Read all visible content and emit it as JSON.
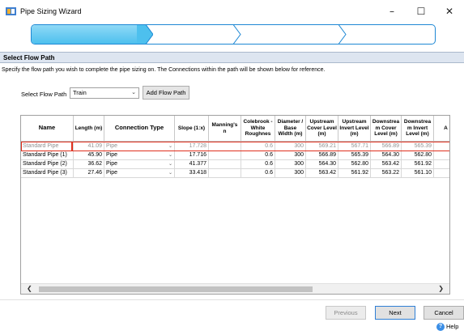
{
  "window": {
    "title": "Pipe Sizing Wizard",
    "minimize": "–",
    "maximize": "☐",
    "close": "✕"
  },
  "section": {
    "title": "Select Flow Path",
    "instruction": "Specify the flow path you wish to complete the pipe sizing on. The Connections within the path will be shown below for reference."
  },
  "flow_path": {
    "label": "Select Flow Path",
    "value": "Train",
    "add_button": "Add Flow Path"
  },
  "table": {
    "columns": [
      "Name",
      "Length (m)",
      "Connection Type",
      "Slope (1:x)",
      "Manning's n",
      "Colebrook -White Roughnes",
      "Diameter / Base Width (m)",
      "Upstream Cover Level (m)",
      "Upstream Invert Level (m)",
      "Downstrea m Cover Level (m)",
      "Downstrea m Invert Level (m)",
      "A"
    ],
    "rows": [
      {
        "name": "Standard Pipe",
        "length": "41.09",
        "type": "Pipe",
        "slope": "17.728",
        "manning": "",
        "colebrook": "0.6",
        "diameter": "300",
        "us_cover": "569.21",
        "us_invert": "567.71",
        "ds_cover": "566.89",
        "ds_invert": "565.39",
        "a": ""
      },
      {
        "name": "Standard Pipe (1)",
        "length": "45.90",
        "type": "Pipe",
        "slope": "17.716",
        "manning": "",
        "colebrook": "0.6",
        "diameter": "300",
        "us_cover": "566.89",
        "us_invert": "565.39",
        "ds_cover": "564.30",
        "ds_invert": "562.80",
        "a": ""
      },
      {
        "name": "Standard Pipe (2)",
        "length": "36.62",
        "type": "Pipe",
        "slope": "41.377",
        "manning": "",
        "colebrook": "0.6",
        "diameter": "300",
        "us_cover": "564.30",
        "us_invert": "562.80",
        "ds_cover": "563.42",
        "ds_invert": "561.92",
        "a": ""
      },
      {
        "name": "Standard Pipe (3)",
        "length": "27.46",
        "type": "Pipe",
        "slope": "33.418",
        "manning": "",
        "colebrook": "0.6",
        "diameter": "300",
        "us_cover": "563.42",
        "us_invert": "561.92",
        "ds_cover": "563.22",
        "ds_invert": "561.10",
        "a": ""
      }
    ]
  },
  "footer": {
    "previous": "Previous",
    "next": "Next",
    "cancel": "Cancel",
    "help": "Help"
  },
  "icons": {
    "app": "pipe-wizard-icon",
    "help": "help-icon",
    "dropdown": "chevron-down-icon"
  },
  "colors": {
    "accent": "#1e88d4",
    "step_active": "#4dc0ee",
    "selection": "#e0301e",
    "section_bg": "#dde5f0"
  }
}
